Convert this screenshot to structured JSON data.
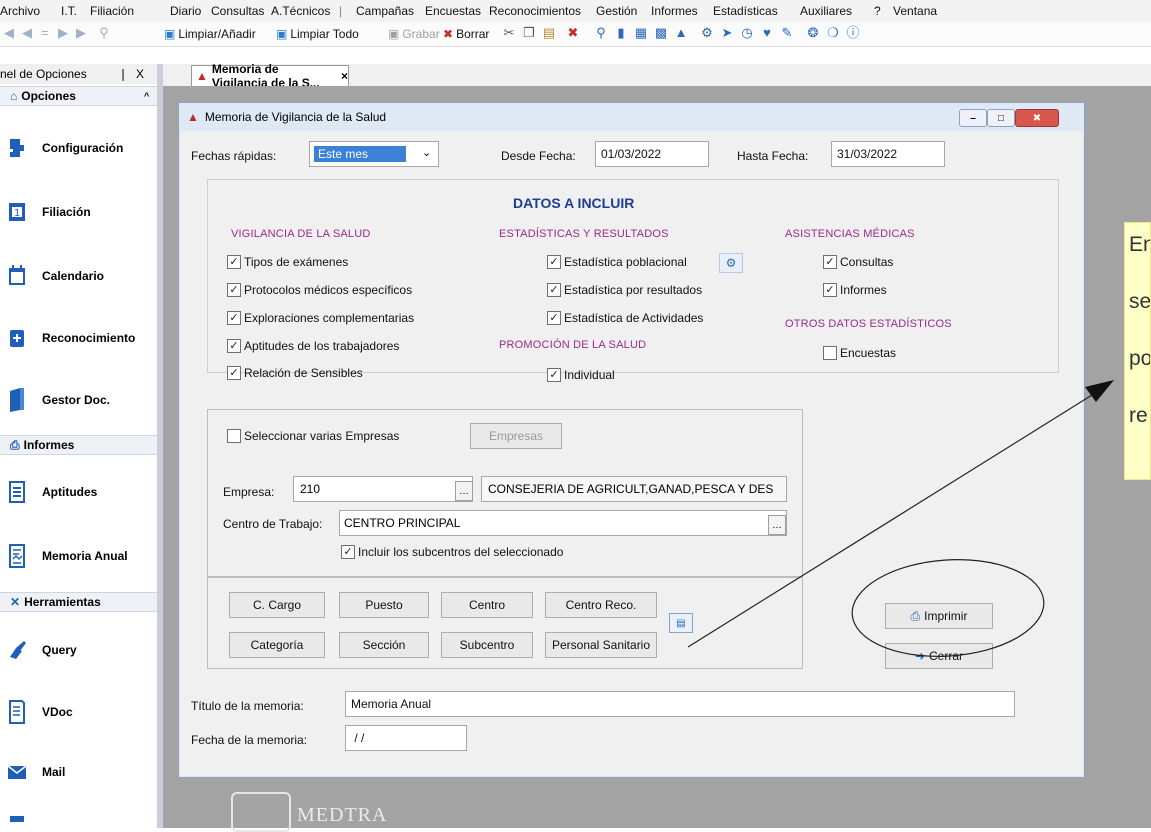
{
  "menu": [
    "Archivo",
    "I.T.",
    "Filiación",
    "Diario",
    "Consultas",
    "A.Técnicos",
    "|",
    "Campañas",
    "Encuestas",
    "Reconocimientos",
    "Gestión",
    "Informes",
    "Estadísticas",
    "Auxiliares",
    "?",
    "Ventana"
  ],
  "toolbar": {
    "limpiar_anadir": "Limpiar/Añadir",
    "limpiar_todo": "Limpiar Todo",
    "grabar": "Grabar",
    "borrar": "Borrar"
  },
  "left_panel": {
    "title": "nel de Opciones",
    "pin": "❘",
    "close": "X",
    "section_opciones": "Opciones",
    "section_informes": "Informes",
    "section_herramientas": "Herramientas",
    "items_opciones": [
      {
        "label": "Configuración",
        "icon": "puzzle-icon"
      },
      {
        "label": "Filiación",
        "icon": "id-card-icon"
      },
      {
        "label": "Calendario",
        "icon": "calendar-icon"
      },
      {
        "label": "Reconocimiento",
        "icon": "medical-icon"
      },
      {
        "label": "Gestor Doc.",
        "icon": "book-icon"
      }
    ],
    "items_informes": [
      {
        "label": "Aptitudes",
        "icon": "document-icon"
      },
      {
        "label": "Memoria Anual",
        "icon": "report-icon"
      }
    ],
    "items_herramientas": [
      {
        "label": "Query",
        "icon": "brush-icon"
      },
      {
        "label": "VDoc",
        "icon": "vdoc-icon"
      },
      {
        "label": "Mail",
        "icon": "mail-icon"
      }
    ]
  },
  "tab": {
    "label": "Memoria de Vigilancia de la S...",
    "close": "×"
  },
  "dialog": {
    "title": "Memoria de Vigilancia de la Salud",
    "fechas_rapidas_label": "Fechas rápidas:",
    "fechas_rapidas_value": "Este mes",
    "desde_label": "Desde Fecha:",
    "desde_value": "01/03/2022",
    "hasta_label": "Hasta Fecha:",
    "hasta_value": "31/03/2022",
    "datos_title": "DATOS A INCLUIR",
    "col1_title": "VIGILANCIA DE LA SALUD",
    "col1_items": [
      "Tipos de exámenes",
      "Protocolos médicos específicos",
      "Exploraciones complementarias",
      "Aptitudes de los trabajadores",
      "Relación de Sensibles"
    ],
    "col2_title": "ESTADÍSTICAS Y RESULTADOS",
    "col2_items": [
      "Estadística poblacional",
      "Estadística por resultados",
      "Estadística de Actividades"
    ],
    "col2b_title": "PROMOCIÓN DE LA SALUD",
    "col2b_items": [
      "Individual"
    ],
    "col3_title": "ASISTENCIAS MÉDICAS",
    "col3_items": [
      "Consultas",
      "Informes"
    ],
    "col3b_title": "OTROS DATOS ESTADÍSTICOS",
    "col3b_items": [
      "Encuestas"
    ],
    "varias_empresas_label": "Seleccionar varias Empresas",
    "empresas_button": "Empresas",
    "empresa_label": "Empresa:",
    "empresa_code": "210",
    "empresa_name": "CONSEJERIA DE AGRICULT,GANAD,PESCA Y DES",
    "centro_label": "Centro de Trabajo:",
    "centro_value": "CENTRO PRINCIPAL",
    "subcentros_label": "Incluir los subcentros del seleccionado",
    "group_buttons_row1": [
      "C. Cargo",
      "Puesto",
      "Centro",
      "Centro Reco."
    ],
    "group_buttons_row2": [
      "Categoría",
      "Sección",
      "Subcentro",
      "Personal Sanitario"
    ],
    "imprimir": "Imprimir",
    "cerrar": "Cerrar",
    "titulo_label": "Título de  la memoria:",
    "titulo_value": "Memoria Anual",
    "fecha_memoria_label": "Fecha de la memoria:",
    "fecha_memoria_value": " / /"
  },
  "tooltip_lines": [
    "En",
    "se",
    "po",
    "re"
  ],
  "logo_text": "MEDTRA",
  "colors": {
    "accent_pink": "#9a2a88",
    "datos_blue": "#1c3f94",
    "tooltip_bg": "#ffffc8",
    "workspace": "#a3a3a3"
  }
}
